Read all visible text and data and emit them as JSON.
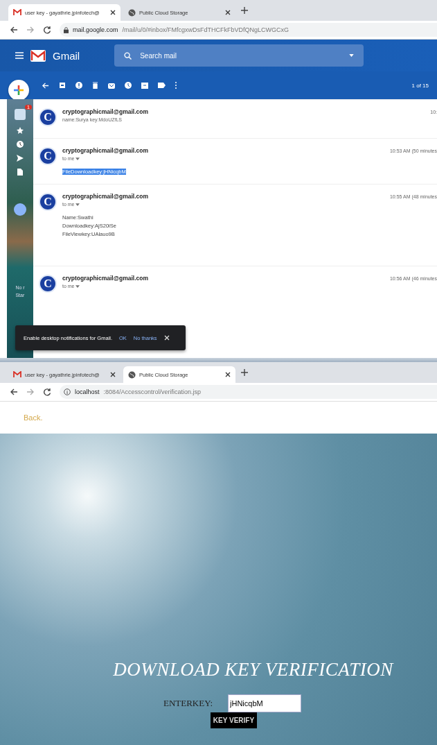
{
  "top_browser": {
    "tabs": [
      {
        "title": "user key - gayathrie.jpinfotech@",
        "selected": true
      },
      {
        "title": "Public Cloud Storage",
        "selected": false
      }
    ],
    "address": {
      "host": "mail.google.com",
      "path": "/mail/u/0/#inbox/FMfcgxwDsFdTHCFkFbVDfQNgLCWGCxG"
    }
  },
  "gmail": {
    "logo_text": "Gmail",
    "search": {
      "placeholder": "Search mail"
    },
    "counter": "1 of 15",
    "sidebar_badge": "1",
    "sidebar_texts": [
      "No r",
      "Star"
    ],
    "messages": [
      {
        "kind": "collapsed",
        "avatar": "C",
        "sender": "cryptographicmail@gmail.com",
        "time": "10:",
        "snippet": "name:Surya key:MdoUZfLS"
      },
      {
        "kind": "expanded",
        "avatar": "C",
        "sender": "cryptographicmail@gmail.com",
        "time": "10:53 AM (50 minutes",
        "recipient": "to me",
        "body": [
          {
            "text": "FileDownloadkey:jHNicqbM",
            "highlighted": true
          }
        ]
      },
      {
        "kind": "expanded",
        "avatar": "C",
        "sender": "cryptographicmail@gmail.com",
        "time": "10:55 AM (48 minutes",
        "recipient": "to me",
        "body": [
          {
            "text": "Name:Swathi",
            "highlighted": false
          },
          {
            "text": "Downloadkey:AjS20iSe",
            "highlighted": false
          },
          {
            "text": "FileViewkey:UAlauo9B",
            "highlighted": false
          }
        ]
      },
      {
        "kind": "expanded",
        "avatar": "C",
        "sender": "cryptographicmail@gmail.com",
        "time": "10:56 AM (46 minutes",
        "recipient": "to me"
      }
    ],
    "toast": {
      "text": "Enable desktop notifications for Gmail.",
      "actions": [
        "OK",
        "No thanks"
      ]
    }
  },
  "bottom_browser": {
    "tabs": [
      {
        "title": "user key - gayathrie.jpinfotech@",
        "selected": false
      },
      {
        "title": "Public Cloud Storage",
        "selected": true
      }
    ],
    "address": {
      "host": "localhost",
      "path": ":8084/Accesscontrol/verification.jsp"
    }
  },
  "verification_page": {
    "back_link": "Back.",
    "title": "DOWNLOAD KEY VERIFICATION",
    "key_label": "ENTERKEY:",
    "key_value": "jHNicqbM",
    "submit": "KEY VERIFY"
  }
}
